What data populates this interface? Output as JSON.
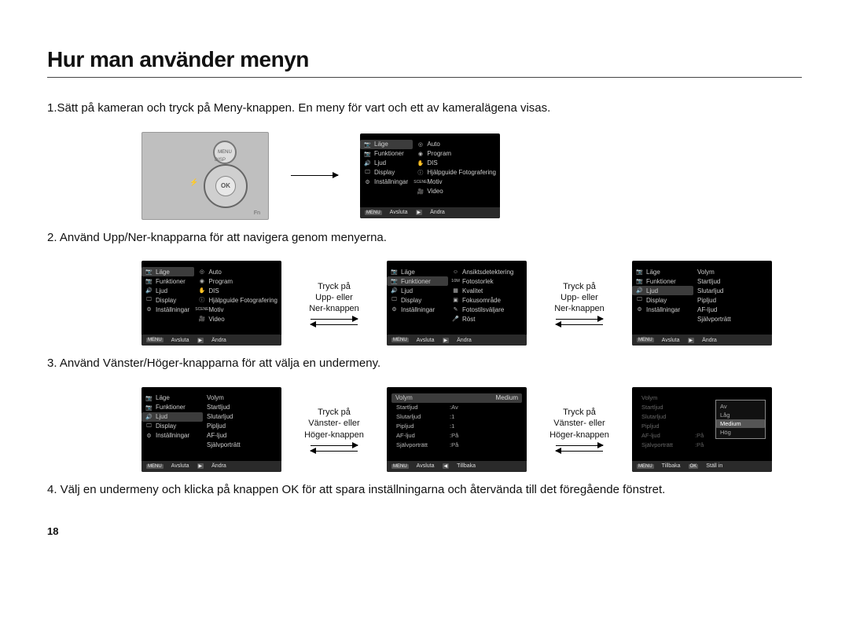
{
  "page_number": "18",
  "title": "Hur man använder menyn",
  "step1": "1.Sätt på kameran och tryck på Meny-knappen. En meny för vart och ett av kameralägena visas.",
  "step2": "2. Använd Upp/Ner-knapparna för att navigera genom menyerna.",
  "step3": "3. Använd Vänster/Höger-knapparna för att välja en undermeny.",
  "step4": "4. Välj en undermeny och klicka på knappen OK för att spara inställningarna och återvända till det föregående fönstret.",
  "camera": {
    "menu": "MENU",
    "ok": "OK",
    "disp": "DISP",
    "flash": "⚡",
    "fn": "Fn"
  },
  "arrow_updown": "Tryck på\nUpp- eller\nNer-knappen",
  "arrow_leftright": "Tryck på\nVänster- eller\nHöger-knappen",
  "left_menu": {
    "lage": "Läge",
    "funktioner": "Funktioner",
    "ljud": "Ljud",
    "display": "Display",
    "installningar": "Inställningar"
  },
  "modes": {
    "auto": "Auto",
    "program": "Program",
    "dis": "DIS",
    "guide": "Hjälpguide Fotografering",
    "motiv": "Motiv",
    "video": "Video"
  },
  "funktioner_sub": {
    "ansikt": "Ansiktsdetektering",
    "fotostorlek": "Fotostorlek",
    "kvalitet": "Kvalitet",
    "fokus": "Fokusområde",
    "fotostil": "Fotostilsväljare",
    "rost": "Röst"
  },
  "ljud_sub": {
    "volym": "Volym",
    "startljud": "Startljud",
    "slutarljud": "Slutarljud",
    "pipljud": "Pipljud",
    "afljud": "AF-ljud",
    "sjalvportratt": "Självporträtt"
  },
  "ljud_vals": {
    "volym_val": "Medium",
    "startljud_val": "Av",
    "slutarljud_val": ":1",
    "pipljud_val": ":1",
    "afljud_val": ":På",
    "sjalvportratt_val": ":På"
  },
  "volym_options": {
    "av": "Av",
    "lag": "Låg",
    "medium": "Medium",
    "hog": "Hög"
  },
  "foot": {
    "menu_tag": "MENU",
    "ok_tag": "OK",
    "play_tag": "▶",
    "back_tag": "◀",
    "avsluta": "Avsluta",
    "andra": "Ändra",
    "tillbaka": "Tillbaka",
    "stallin": "Ställ in"
  }
}
